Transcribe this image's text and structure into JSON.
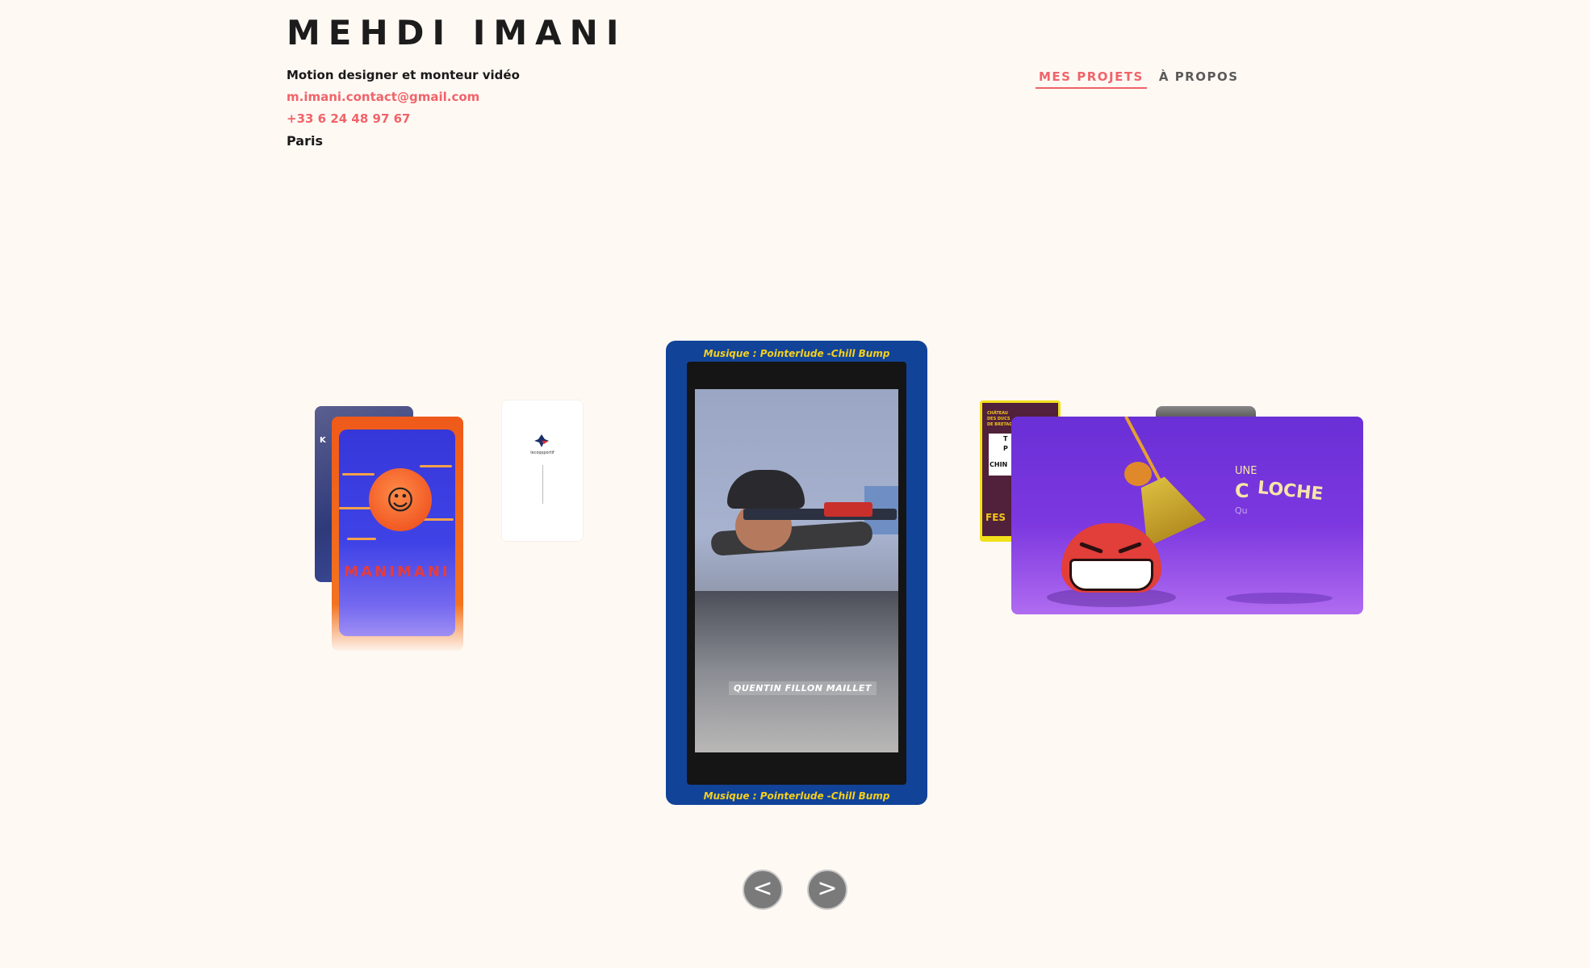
{
  "header": {
    "name": "MEHDI IMANI",
    "subtitle": "Motion designer et monteur vidéo",
    "email": "m.imani.contact@gmail.com",
    "phone": "+33 6 24 48 97 67",
    "city": "Paris"
  },
  "nav": {
    "projects": "MES PROJETS",
    "about": "À PROPOS"
  },
  "colors": {
    "accent": "#f0646a",
    "background": "#fff9f4",
    "center_card": "#114399"
  },
  "carousel": {
    "back_card_text": "K",
    "manimani_title": "MANIMANI",
    "center_music_top": "Musique : Pointerlude -Chill Bump",
    "center_music_bottom": "Musique : Pointerlude -Chill Bump",
    "center_caption": "QUENTIN FILLON MAILLET",
    "white_card_brand": "lecoqsportif",
    "festival_lines": [
      "CHÂTEAU",
      "DES DUCS",
      "DE BRETAGNE"
    ],
    "festival_box_letters": [
      "T",
      "P",
      "CHIN"
    ],
    "festival_bottom": "FES",
    "cloche_une": "UNE",
    "cloche_c": "C",
    "cloche_loche": "LOCHE",
    "cloche_qu": "Qu"
  },
  "controls": {
    "prev": "<",
    "next": ">"
  },
  "icons": {
    "prev": "chevron-left-icon",
    "next": "chevron-right-icon",
    "logo": "rooster-logo-icon"
  }
}
